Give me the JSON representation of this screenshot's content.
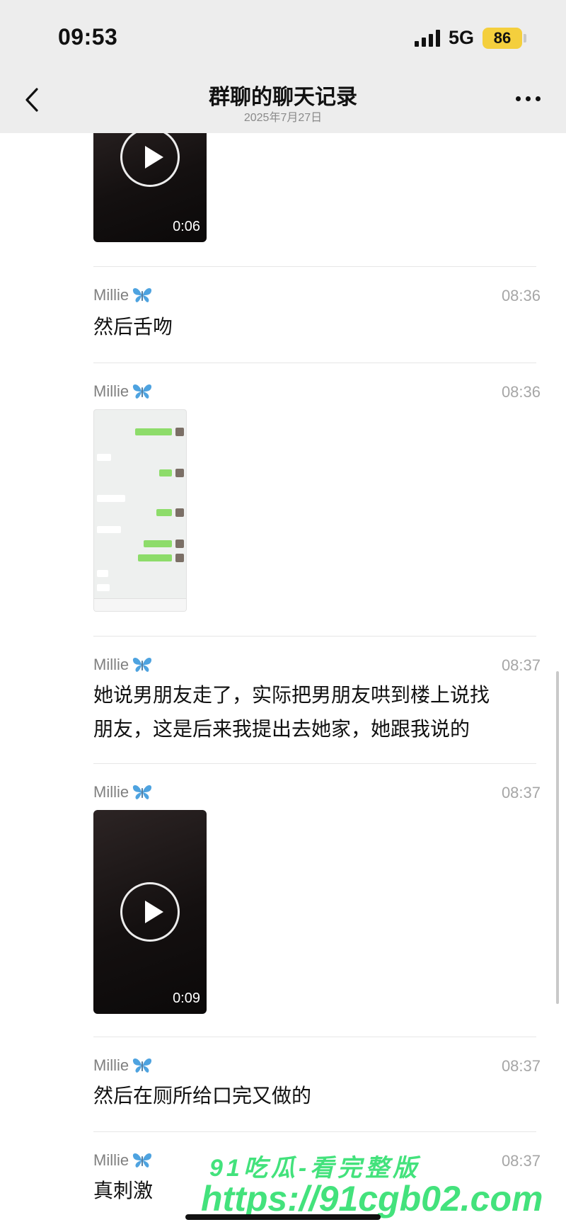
{
  "status_bar": {
    "time": "09:53",
    "network": "5G",
    "battery": "86"
  },
  "nav": {
    "title": "群聊的聊天记录",
    "date": "2025年7月27日"
  },
  "records": [
    {
      "type": "video",
      "duration": "0:06"
    },
    {
      "sender": "Millie",
      "time": "08:36",
      "type": "text",
      "text": "然后舌吻"
    },
    {
      "sender": "Millie",
      "time": "08:36",
      "type": "image"
    },
    {
      "sender": "Millie",
      "time": "08:37",
      "type": "text",
      "lines": [
        "她说男朋友走了，实际把男朋友哄到楼上说找",
        "朋友，这是后来我提出去她家，她跟我说的"
      ]
    },
    {
      "sender": "Millie",
      "time": "08:37",
      "type": "video",
      "duration": "0:09"
    },
    {
      "sender": "Millie",
      "time": "08:37",
      "type": "text",
      "text": "然后在厕所给口完又做的"
    },
    {
      "sender": "Millie",
      "time": "08:37",
      "type": "text",
      "text": "真刺激"
    }
  ],
  "watermark": {
    "line1": "91吃瓜-看完整版",
    "line2": "https://91cgb02.com"
  },
  "colors": {
    "butterfly": "#4ea3e0",
    "battery": "#f4cf3d",
    "watermark": "#43e27c"
  },
  "icons": [
    "back-chevron-icon",
    "more-dots-icon",
    "signal-icon",
    "battery-icon",
    "play-icon",
    "butterfly-icon"
  ]
}
